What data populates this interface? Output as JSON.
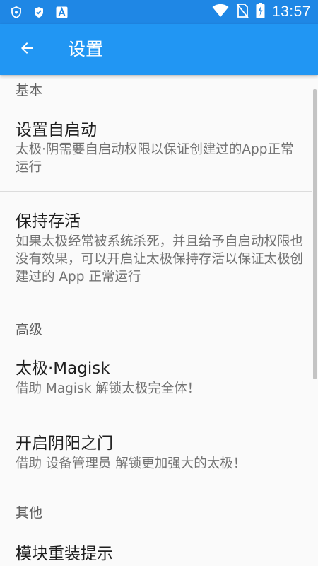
{
  "status_bar": {
    "time": "13:57",
    "left_icons": [
      "shield-icon",
      "shield-icon",
      "app-a-icon"
    ],
    "right_icons": [
      "wifi-icon",
      "no-sim-icon",
      "battery-charging-icon"
    ]
  },
  "app_bar": {
    "title": "设置",
    "back_icon": "arrow-left-icon"
  },
  "sections": {
    "basic": {
      "header": "基本",
      "items": [
        {
          "title": "设置自启动",
          "summary": "太极·阴需要自启动权限以保证创建过的App正常运行"
        },
        {
          "title": "保持存活",
          "summary": "如果太极经常被系统杀死，并且给予自启动权限也没有效果，可以开启让太极保持存活以保证太极创建过的 App 正常运行"
        }
      ]
    },
    "advanced": {
      "header": "高级",
      "items": [
        {
          "title": "太极·Magisk",
          "summary": "借助 Magisk 解锁太极完全体！"
        },
        {
          "title": "开启阴阳之门",
          "summary": "借助 设备管理员 解锁更加强大的太极！"
        }
      ]
    },
    "other": {
      "header": "其他",
      "items": [
        {
          "title": "模块重装提示",
          "summary": ""
        }
      ]
    }
  },
  "colors": {
    "app_bar": "#2196f3",
    "status_bar": "#1f87e5",
    "background": "#fafafa"
  }
}
